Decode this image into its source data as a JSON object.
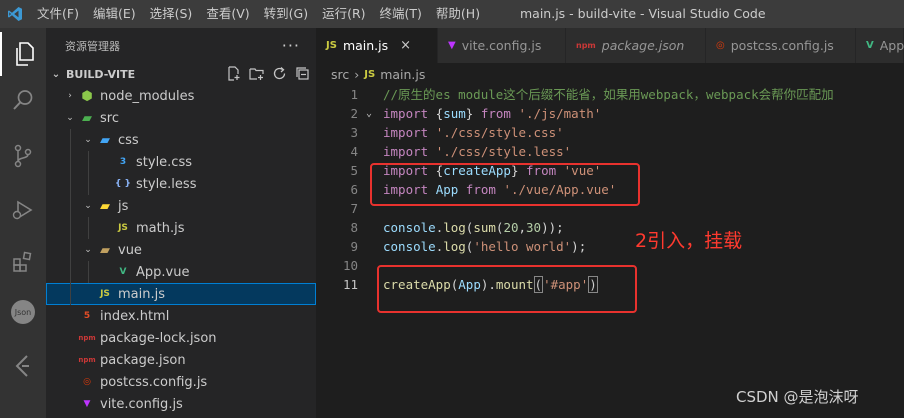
{
  "titlebar": {
    "menu": [
      "文件(F)",
      "编辑(E)",
      "选择(S)",
      "查看(V)",
      "转到(G)",
      "运行(R)",
      "终端(T)",
      "帮助(H)"
    ],
    "window_title": "main.js - build-vite - Visual Studio Code"
  },
  "activitybar": {
    "items": [
      "explorer-icon",
      "search-icon",
      "source-control-icon",
      "run-debug-icon",
      "extensions-icon",
      "json-icon",
      "remote-icon"
    ]
  },
  "sidebar": {
    "header": "资源管理器",
    "more": "···",
    "project": "BUILD-VITE",
    "tree": [
      {
        "label": "node_modules",
        "kind": "folder-node",
        "depth": 1,
        "twisty": "›"
      },
      {
        "label": "src",
        "kind": "folder-src",
        "depth": 1,
        "twisty": "⌄"
      },
      {
        "label": "css",
        "kind": "folder-css",
        "depth": 2,
        "twisty": "⌄"
      },
      {
        "label": "style.css",
        "kind": "css",
        "depth": 3
      },
      {
        "label": "style.less",
        "kind": "less",
        "depth": 3
      },
      {
        "label": "js",
        "kind": "folder-js",
        "depth": 2,
        "twisty": "⌄"
      },
      {
        "label": "math.js",
        "kind": "js",
        "depth": 3
      },
      {
        "label": "vue",
        "kind": "folder-vue",
        "depth": 2,
        "twisty": "⌄"
      },
      {
        "label": "App.vue",
        "kind": "vue",
        "depth": 3
      },
      {
        "label": "main.js",
        "kind": "js",
        "depth": 2,
        "selected": true
      },
      {
        "label": "index.html",
        "kind": "html",
        "depth": 1
      },
      {
        "label": "package-lock.json",
        "kind": "npm",
        "depth": 1
      },
      {
        "label": "package.json",
        "kind": "npm",
        "depth": 1
      },
      {
        "label": "postcss.config.js",
        "kind": "postcss",
        "depth": 1
      },
      {
        "label": "vite.config.js",
        "kind": "vite",
        "depth": 1
      }
    ]
  },
  "tabs": [
    {
      "label": "main.js",
      "icon": "JS",
      "active": true,
      "close": "×"
    },
    {
      "label": "vite.config.js",
      "icon": "vite"
    },
    {
      "label": "package.json",
      "icon": "npm",
      "italic": true
    },
    {
      "label": "postcss.config.js",
      "icon": "postcss"
    },
    {
      "label": "App",
      "icon": "vue"
    }
  ],
  "breadcrumb": {
    "folder": "src",
    "sep": "›",
    "icon": "JS",
    "file": "main.js"
  },
  "code": [
    {
      "n": "1",
      "tokens": [
        [
          "cmt",
          "//原生的es module这个后缀不能省，如果用webpack，webpack会帮你匹配加"
        ]
      ]
    },
    {
      "n": "2",
      "fold": "⌄",
      "tokens": [
        [
          "kw",
          "import"
        ],
        [
          "pun",
          " {"
        ],
        [
          "var",
          "sum"
        ],
        [
          "pun",
          "} "
        ],
        [
          "kw",
          "from"
        ],
        [
          "pun",
          " "
        ],
        [
          "str",
          "'./js/math'"
        ]
      ]
    },
    {
      "n": "3",
      "tokens": [
        [
          "kw",
          "import"
        ],
        [
          "pun",
          " "
        ],
        [
          "str",
          "'./css/style.css'"
        ]
      ]
    },
    {
      "n": "4",
      "tokens": [
        [
          "kw",
          "import"
        ],
        [
          "pun",
          " "
        ],
        [
          "str",
          "'./css/style.less'"
        ]
      ]
    },
    {
      "n": "5",
      "tokens": [
        [
          "kw",
          "import"
        ],
        [
          "pun",
          " {"
        ],
        [
          "var",
          "createApp"
        ],
        [
          "pun",
          "} "
        ],
        [
          "kw",
          "from"
        ],
        [
          "pun",
          " "
        ],
        [
          "str",
          "'vue'"
        ]
      ]
    },
    {
      "n": "6",
      "tokens": [
        [
          "kw",
          "import"
        ],
        [
          "pun",
          " "
        ],
        [
          "var",
          "App"
        ],
        [
          "pun",
          " "
        ],
        [
          "kw",
          "from"
        ],
        [
          "pun",
          " "
        ],
        [
          "str",
          "'./vue/App.vue'"
        ]
      ]
    },
    {
      "n": "7",
      "tokens": []
    },
    {
      "n": "8",
      "tokens": [
        [
          "var",
          "console"
        ],
        [
          "pun",
          "."
        ],
        [
          "fn",
          "log"
        ],
        [
          "pun",
          "("
        ],
        [
          "fn",
          "sum"
        ],
        [
          "pun",
          "("
        ],
        [
          "num",
          "20"
        ],
        [
          "pun",
          ","
        ],
        [
          "num",
          "30"
        ],
        [
          "pun",
          "));"
        ]
      ]
    },
    {
      "n": "9",
      "tokens": [
        [
          "var",
          "console"
        ],
        [
          "pun",
          "."
        ],
        [
          "fn",
          "log"
        ],
        [
          "pun",
          "("
        ],
        [
          "str",
          "'hello world'"
        ],
        [
          "pun",
          ");"
        ]
      ]
    },
    {
      "n": "10",
      "tokens": []
    },
    {
      "n": "11",
      "current": true,
      "tokens": [
        [
          "fn",
          "createApp"
        ],
        [
          "pun",
          "("
        ],
        [
          "var",
          "App"
        ],
        [
          "pun",
          ")."
        ],
        [
          "fn",
          "mount"
        ],
        [
          "brk",
          "("
        ],
        [
          "str",
          "'#app'"
        ],
        [
          "brk",
          ")"
        ]
      ]
    }
  ],
  "annotation": "2引入，挂载",
  "watermark": "CSDN @是泡沫呀",
  "colors": {
    "annotation_red": "#e8322e",
    "selection": "#04395e",
    "accent": "#007fd4"
  }
}
